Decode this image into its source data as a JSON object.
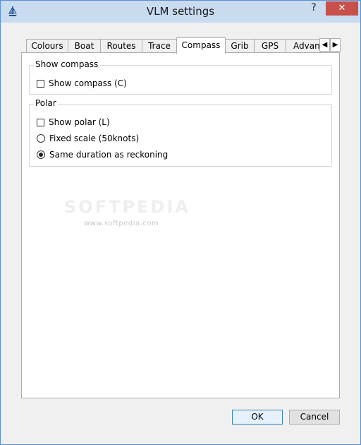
{
  "window": {
    "title": "VLM settings",
    "help_label": "?",
    "close_label": "✕"
  },
  "tabs": [
    {
      "label": "Colours",
      "active": false
    },
    {
      "label": "Boat",
      "active": false
    },
    {
      "label": "Routes",
      "active": false
    },
    {
      "label": "Trace",
      "active": false
    },
    {
      "label": "Compass",
      "active": true
    },
    {
      "label": "Grib",
      "active": false
    },
    {
      "label": "GPS",
      "active": false
    },
    {
      "label": "Advanc",
      "active": false
    }
  ],
  "tab_scroll": {
    "left": "◀",
    "right": "▶"
  },
  "show_compass_group": {
    "title": "Show compass",
    "show_compass": {
      "label": "Show compass (C)",
      "checked": false
    }
  },
  "polar_group": {
    "title": "Polar",
    "show_polar": {
      "label": "Show polar (L)",
      "checked": false
    },
    "fixed_scale": {
      "label": "Fixed scale (50knots)",
      "selected": false
    },
    "same_duration": {
      "label": "Same duration as reckoning",
      "selected": true
    }
  },
  "watermark": {
    "big": "SOFTPEDIA",
    "small": "www.softpedia.com"
  },
  "buttons": {
    "ok": "OK",
    "cancel": "Cancel"
  }
}
